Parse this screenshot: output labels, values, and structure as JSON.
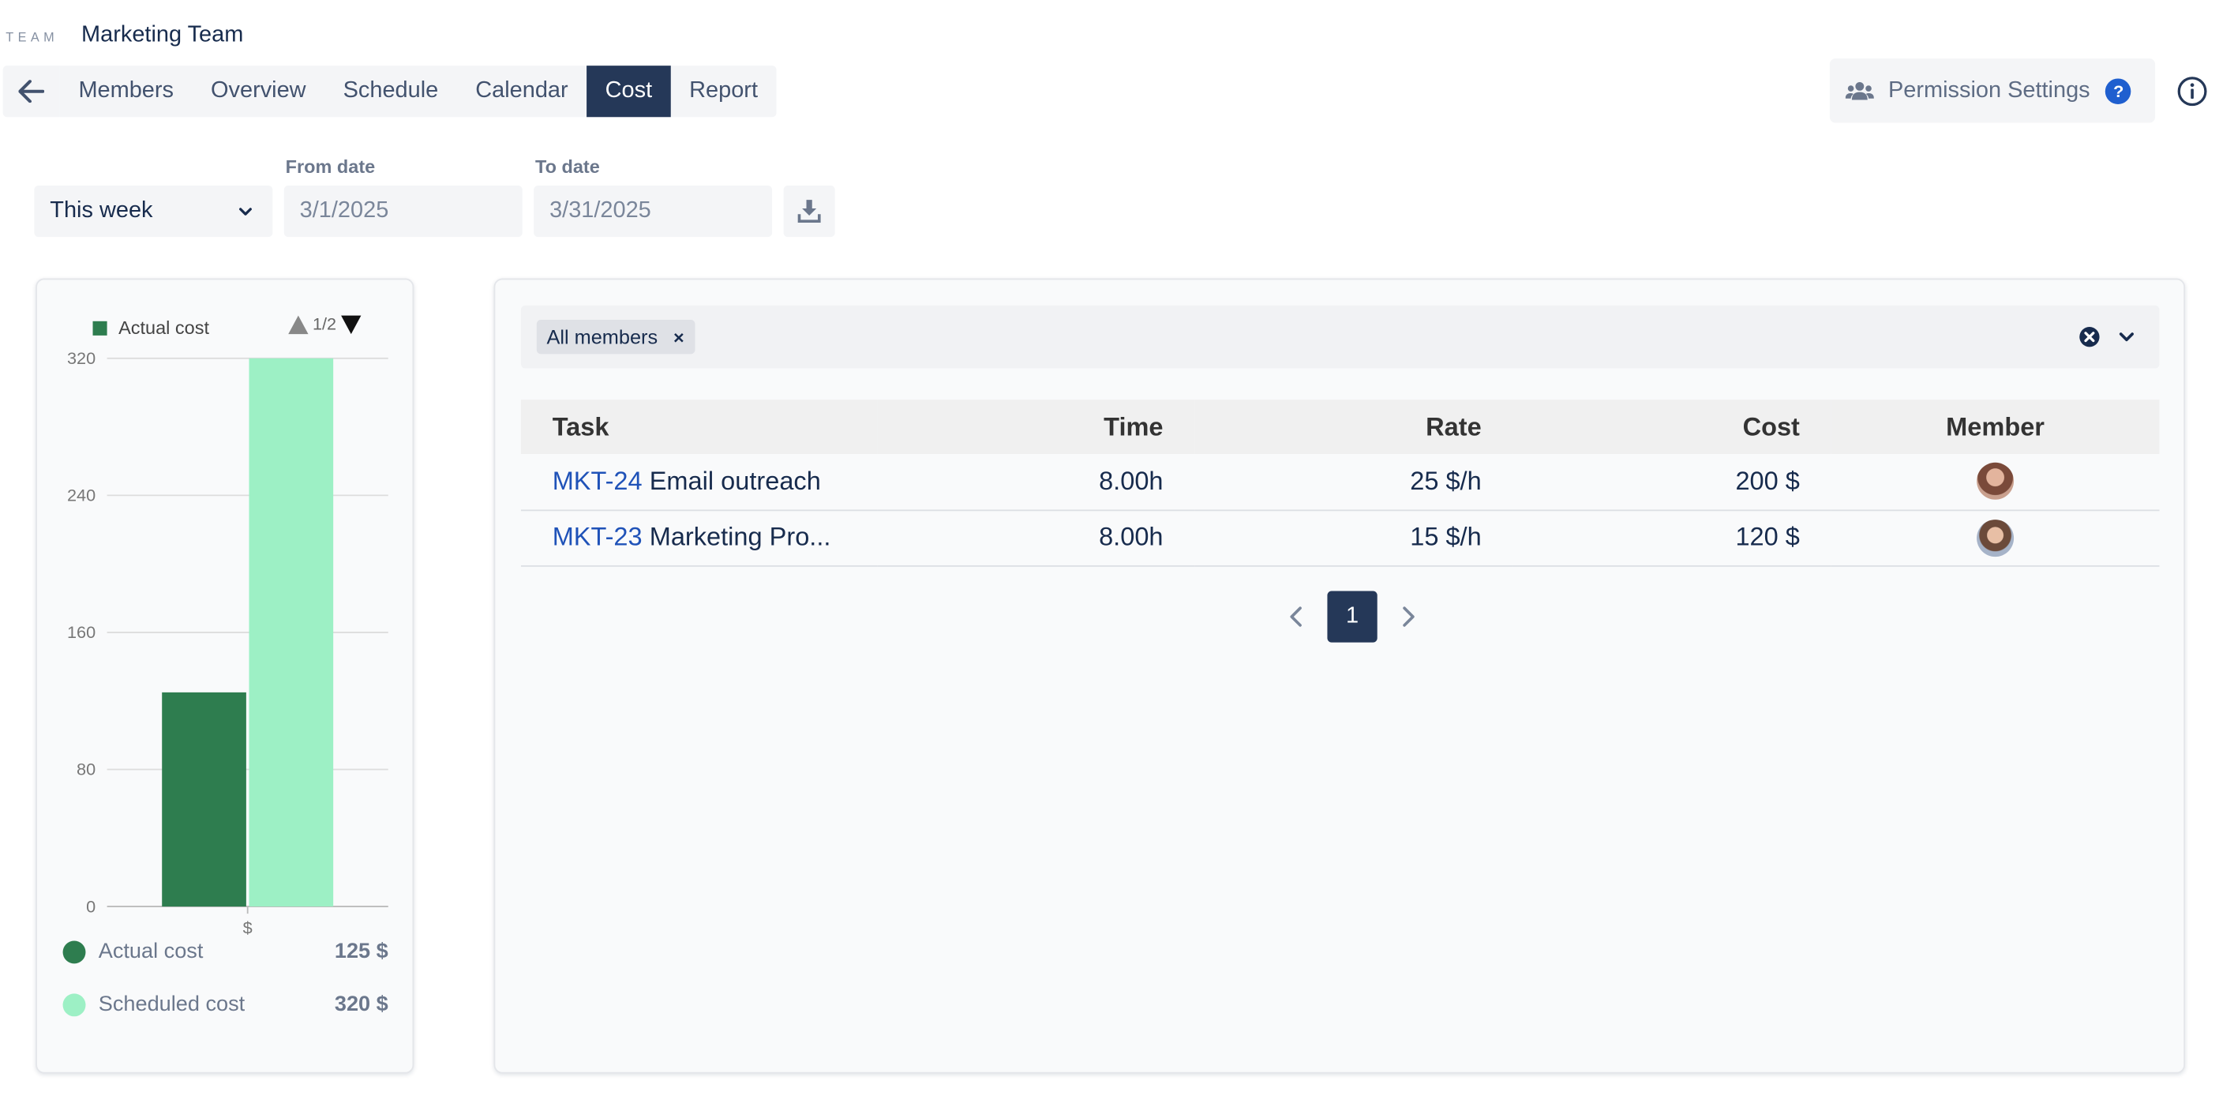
{
  "header": {
    "team_label": "TEAM",
    "team_name": "Marketing Team",
    "tabs": [
      {
        "label": "Members"
      },
      {
        "label": "Overview"
      },
      {
        "label": "Schedule"
      },
      {
        "label": "Calendar"
      },
      {
        "label": "Cost"
      },
      {
        "label": "Report"
      }
    ],
    "active_tab": "Cost",
    "permission_settings_label": "Permission Settings",
    "help_glyph": "?"
  },
  "filters": {
    "period_value": "This week",
    "from_label": "From date",
    "from_value": "3/1/2025",
    "to_label": "To date",
    "to_value": "3/31/2025"
  },
  "chart": {
    "legend_label": "Actual cost",
    "pager": "1/2",
    "summary": [
      {
        "label": "Actual cost",
        "value": "125 $",
        "color": "#2e7d4f"
      },
      {
        "label": "Scheduled cost",
        "value": "320 $",
        "color": "#9df0c5"
      }
    ]
  },
  "chart_data": {
    "type": "bar",
    "categories": [
      "$"
    ],
    "series": [
      {
        "name": "Actual cost",
        "values": [
          125
        ],
        "color": "#2e7d4f"
      },
      {
        "name": "Scheduled cost",
        "values": [
          320
        ],
        "color": "#9df0c5"
      }
    ],
    "yticks": [
      0,
      80,
      160,
      240,
      320
    ],
    "ylim": [
      0,
      320
    ],
    "grid": true,
    "legend_placement": "top-left"
  },
  "table": {
    "filter_chip": "All members",
    "chip_close_glyph": "×",
    "columns": [
      "Task",
      "Time",
      "Rate",
      "Cost",
      "Member"
    ],
    "rows": [
      {
        "key": "MKT-24",
        "title": "Email outreach",
        "time": "8.00h",
        "rate": "25 $/h",
        "cost": "200 $"
      },
      {
        "key": "MKT-23",
        "title": "Marketing Pro...",
        "time": "8.00h",
        "rate": "15 $/h",
        "cost": "120 $"
      }
    ],
    "current_page": "1"
  }
}
